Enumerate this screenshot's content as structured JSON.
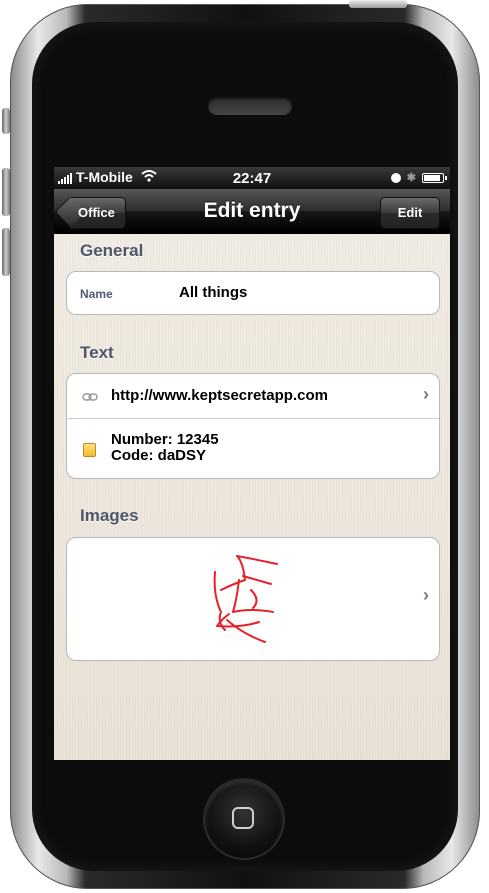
{
  "status": {
    "carrier": "T-Mobile",
    "time": "22:47"
  },
  "navbar": {
    "back_label": "Office",
    "title": "Edit entry",
    "edit_label": "Edit"
  },
  "general": {
    "title": "General",
    "name_label": "Name",
    "name_value": "All things"
  },
  "text": {
    "title": "Text",
    "url": "http://www.keptsecretapp.com",
    "note_line1": "Number: 12345",
    "note_line2": "Code: daDSY"
  },
  "images": {
    "title": "Images"
  },
  "colors": {
    "section_title": "#4d566b",
    "sketch": "#e8202a"
  }
}
